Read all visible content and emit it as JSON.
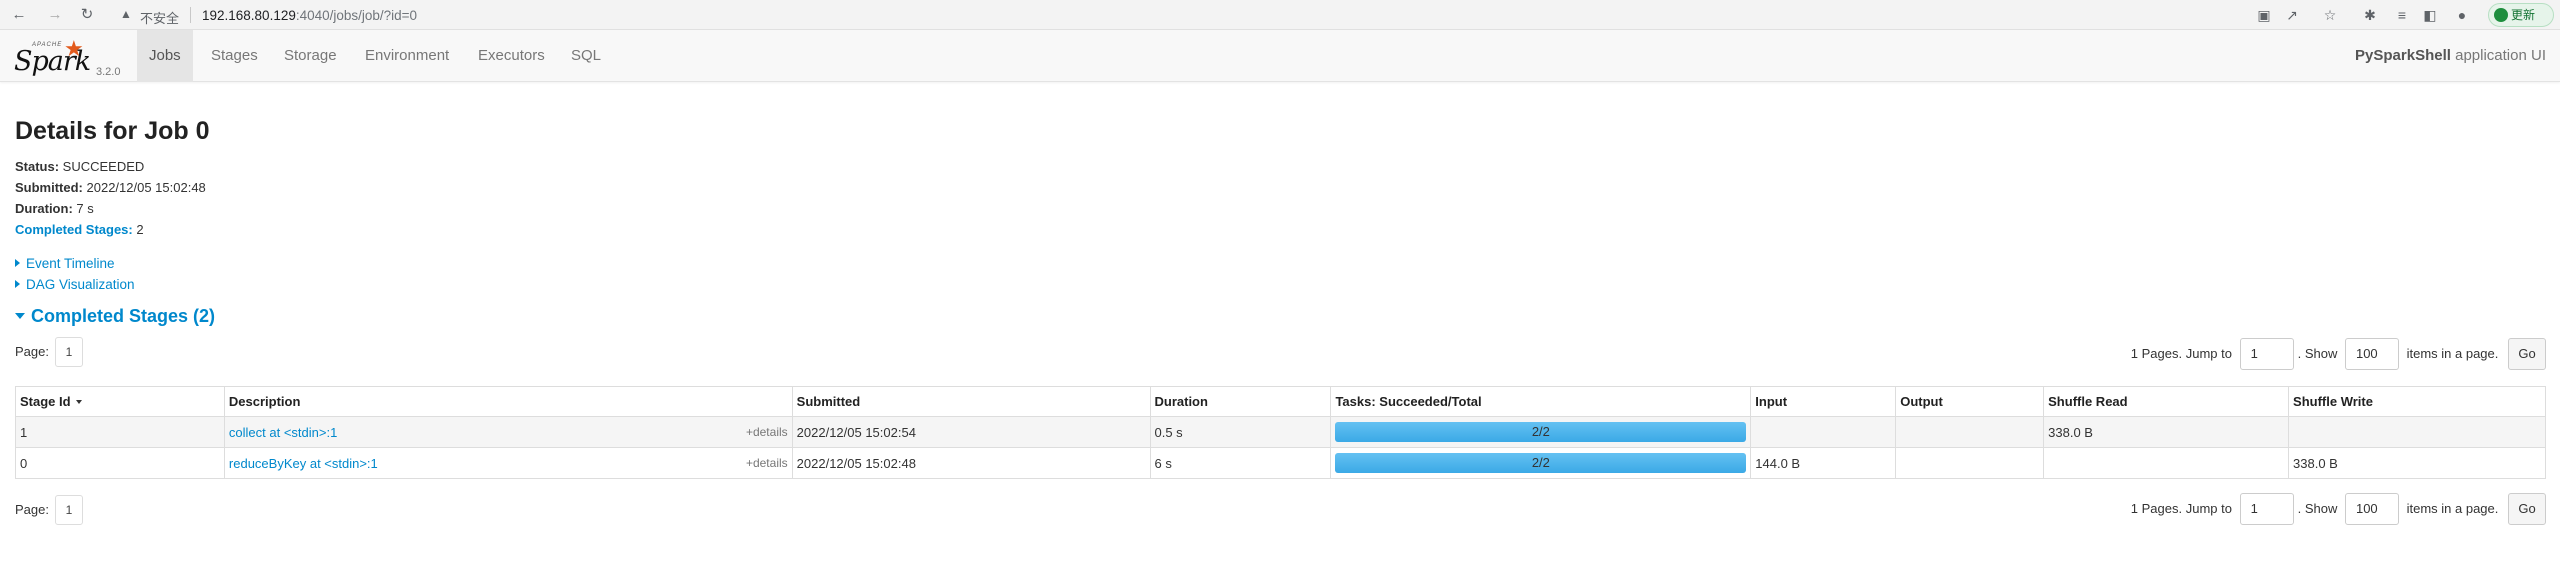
{
  "browser": {
    "insecure_label": "不安全",
    "url_host": "192.168.80.129",
    "url_path": ":4040/jobs/job/?id=0",
    "update_label": "更新"
  },
  "navbar": {
    "brand_name": "Spark",
    "brand_apache": "APACHE",
    "version": "3.2.0",
    "tabs": [
      {
        "label": "Jobs",
        "active": true
      },
      {
        "label": "Stages"
      },
      {
        "label": "Storage"
      },
      {
        "label": "Environment"
      },
      {
        "label": "Executors"
      },
      {
        "label": "SQL"
      }
    ],
    "app_name": "PySparkShell",
    "app_suffix": " application UI"
  },
  "page": {
    "title": "Details for Job 0",
    "status_key": "Status:",
    "status_val": " SUCCEEDED",
    "submitted_key": "Submitted:",
    "submitted_val": " 2022/12/05 15:02:48",
    "duration_key": "Duration:",
    "duration_val": " 7 s",
    "completed_key": "Completed Stages:",
    "completed_val": " 2",
    "event_timeline": "Event Timeline",
    "dag_visualization": "DAG Visualization",
    "section_title": "Completed Stages (2)"
  },
  "pager": {
    "page_label": "Page:",
    "page_value": "1",
    "pages_text": "1 Pages. Jump to",
    "jump_value": "1",
    "show_text": ". Show",
    "show_value": "100",
    "items_text": "items in a page.",
    "go_label": "Go"
  },
  "table": {
    "headers": [
      "Stage Id",
      "Description",
      "Submitted",
      "Duration",
      "Tasks: Succeeded/Total",
      "Input",
      "Output",
      "Shuffle Read",
      "Shuffle Write"
    ],
    "rows": [
      {
        "id": "1",
        "desc": "collect at <stdin>:1",
        "details": "+details",
        "submitted": "2022/12/05 15:02:54",
        "duration": "0.5 s",
        "tasks": "2/2",
        "progress": 1.0,
        "input": "",
        "output": "",
        "shuffle_read": "338.0 B",
        "shuffle_write": ""
      },
      {
        "id": "0",
        "desc": "reduceByKey at <stdin>:1",
        "details": "+details",
        "submitted": "2022/12/05 15:02:48",
        "duration": "6 s",
        "tasks": "2/2",
        "progress": 1.0,
        "input": "144.0 B",
        "output": "",
        "shuffle_read": "",
        "shuffle_write": "338.0 B"
      }
    ]
  }
}
